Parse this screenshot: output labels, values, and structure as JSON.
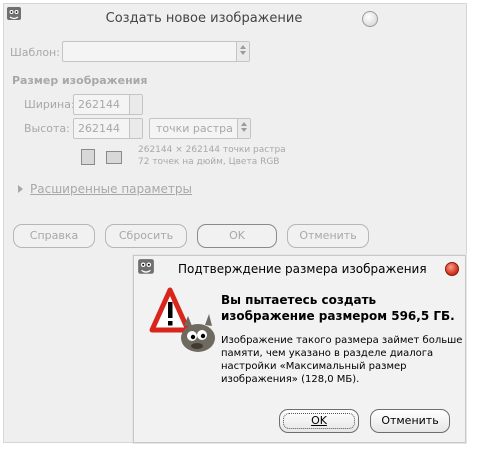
{
  "background_dialog": {
    "title": "Создать новое изображение",
    "template_label": "Шаблон:",
    "template_value": "",
    "image_size_heading": "Размер изображения",
    "width_label": "Ширина:",
    "width_value": "262144",
    "height_label": "Высота:",
    "height_value": "262144",
    "unit_value": "точки растра",
    "info_line1": "262144 × 262144 точки растра",
    "info_line2": "72 точек на дюйм, Цвета RGB",
    "advanced_label": "Расширенные параметры",
    "buttons": {
      "help": "Справка",
      "reset": "Сбросить",
      "ok": "OK",
      "cancel": "Отменить"
    }
  },
  "confirm_dialog": {
    "title": "Подтверждение размера изображения",
    "heading_line1": "Вы пытаетесь создать",
    "heading_line2": "изображение размером 596,5 ГБ.",
    "body_line1": "Изображение такого размера займет больше",
    "body_line2": "памяти, чем указано в разделе диалога",
    "body_line3": "настройки «Максимальный размер",
    "body_line4": "изображения» (128,0 МБ).",
    "buttons": {
      "ok": "OK",
      "cancel": "Отменить"
    }
  },
  "icons": {
    "app": "gimp-wilber-icon",
    "warning": "warning-triangle-icon",
    "close": "close-icon"
  },
  "colors": {
    "warning_red": "#d9261c",
    "close_red": "#d43a24"
  }
}
